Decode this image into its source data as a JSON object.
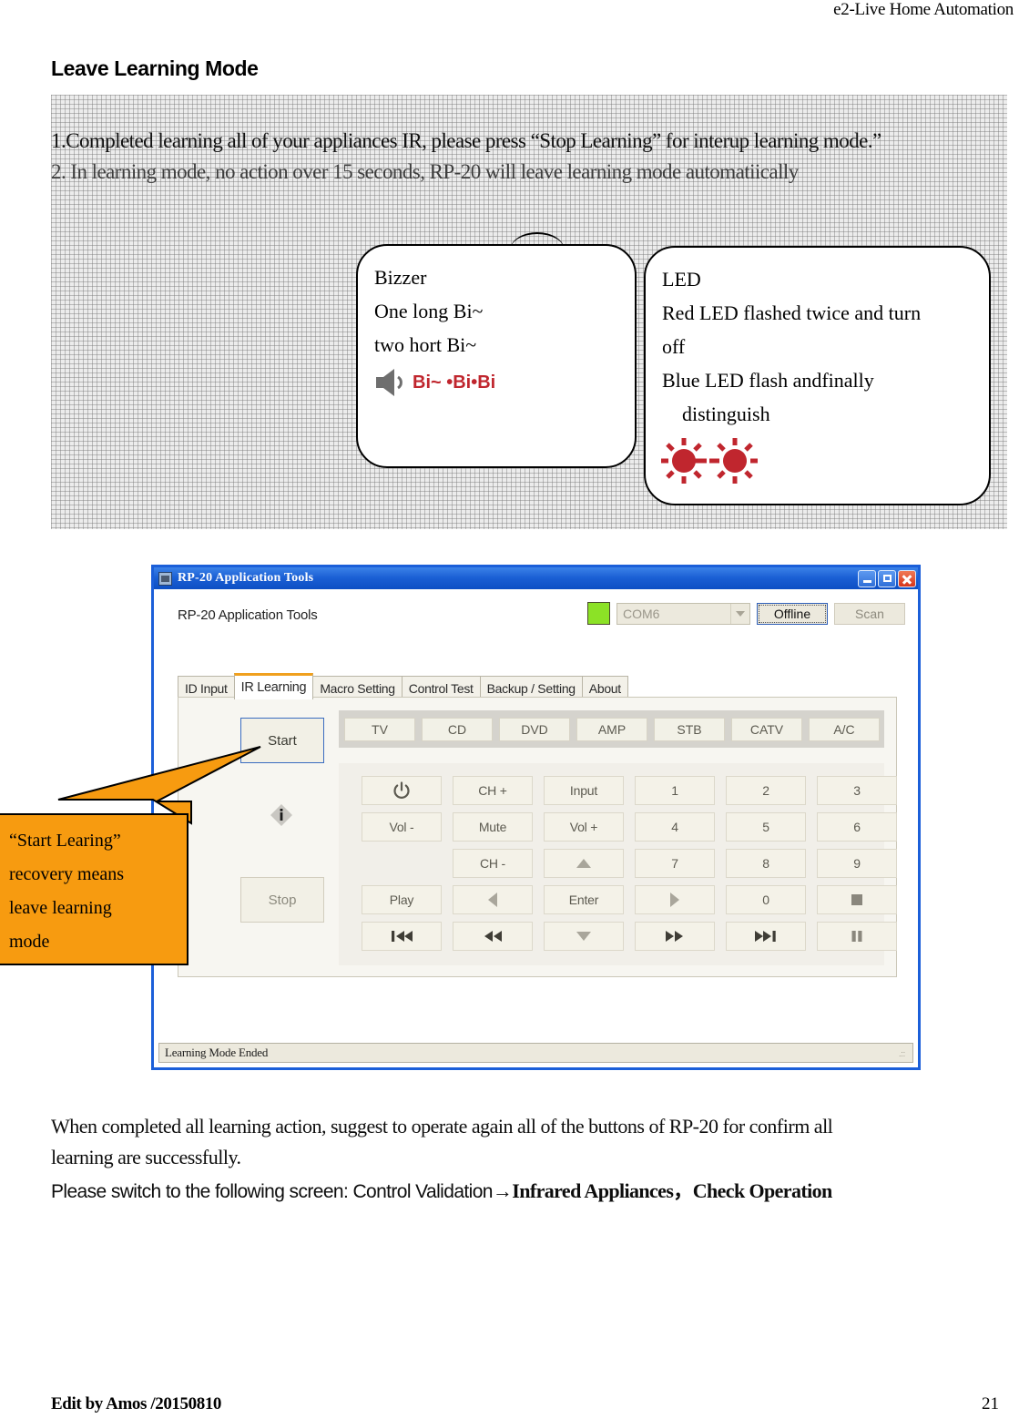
{
  "header": {
    "running_head": "e2-Live Home Automation"
  },
  "section": {
    "title": "Leave Learning Mode",
    "note1": "1.Completed learning all of your appliances IR, please press “Stop Learning” for interup learning mode.”",
    "note2": "2. In learning mode, no action over 15 seconds, RP-20 will leave learning mode automatiically"
  },
  "balloons": {
    "bizzer": {
      "line1": "Bizzer",
      "line2": "One long Bi~",
      "line3": "two hort Bi~",
      "icon": "speaker-icon",
      "beep_text": "Bi~ •Bi•Bi",
      "beep_color": "#c0262e"
    },
    "led": {
      "line1": "LED",
      "line2": "Red LED flashed twice and turn",
      "line3": "off",
      "line4": "Blue LED flash andfinally",
      "line5": "distinguish",
      "icon": "led-flash-icon",
      "icon_color": "#c0262e"
    }
  },
  "app": {
    "title": "RP-20 Application Tools",
    "subtitle": "RP-20 Application Tools",
    "window_buttons": {
      "minimize": "minimize-icon",
      "maximize": "maximize-icon",
      "close": "close-icon"
    },
    "connection": {
      "status_color": "#8ce226",
      "com_port": "COM6",
      "offline_label": "Offline",
      "scan_label": "Scan"
    },
    "tabs": [
      {
        "label": "ID Input",
        "active": false
      },
      {
        "label": "IR Learning",
        "active": true
      },
      {
        "label": "Macro Setting",
        "active": false
      },
      {
        "label": "Control Test",
        "active": false
      },
      {
        "label": "Backup / Setting",
        "active": false
      },
      {
        "label": "About",
        "active": false
      }
    ],
    "active_tab_accent": "#f0a01e",
    "learning_panel": {
      "start_label": "Start",
      "stop_label": "Stop",
      "info_icon": "info-icon"
    },
    "devices": [
      "TV",
      "CD",
      "DVD",
      "AMP",
      "STB",
      "CATV",
      "A/C"
    ],
    "keys": [
      [
        {
          "label": "",
          "icon": "power-icon"
        },
        {
          "label": "CH +",
          "icon": ""
        },
        {
          "label": "Input",
          "icon": ""
        },
        {
          "label": "1",
          "icon": ""
        },
        {
          "label": "2",
          "icon": ""
        },
        {
          "label": "3",
          "icon": ""
        }
      ],
      [
        {
          "label": "Vol -",
          "icon": ""
        },
        {
          "label": "Mute",
          "icon": ""
        },
        {
          "label": "Vol +",
          "icon": ""
        },
        {
          "label": "4",
          "icon": ""
        },
        {
          "label": "5",
          "icon": ""
        },
        {
          "label": "6",
          "icon": ""
        }
      ],
      [
        {
          "label": "",
          "icon": "blank"
        },
        {
          "label": "CH -",
          "icon": ""
        },
        {
          "label": "",
          "icon": "arrow-up-icon"
        },
        {
          "label": "7",
          "icon": ""
        },
        {
          "label": "8",
          "icon": ""
        },
        {
          "label": "9",
          "icon": ""
        }
      ],
      [
        {
          "label": "Play",
          "icon": ""
        },
        {
          "label": "",
          "icon": "arrow-left-icon"
        },
        {
          "label": "Enter",
          "icon": ""
        },
        {
          "label": "",
          "icon": "arrow-right-icon"
        },
        {
          "label": "0",
          "icon": ""
        },
        {
          "label": "",
          "icon": "stop-square-icon"
        }
      ],
      [
        {
          "label": "",
          "icon": "skip-previous-icon"
        },
        {
          "label": "",
          "icon": "rewind-icon"
        },
        {
          "label": "",
          "icon": "arrow-down-icon"
        },
        {
          "label": "",
          "icon": "fast-forward-icon"
        },
        {
          "label": "",
          "icon": "skip-next-icon"
        },
        {
          "label": "",
          "icon": "pause-icon"
        }
      ]
    ],
    "statusbar": "Learning Mode Ended"
  },
  "annotation": {
    "orange_callout": {
      "line1": "“Start Learing”",
      "line2": "recovery means",
      "line3": "leave learning",
      "line4": "mode",
      "color": "#f79b10"
    }
  },
  "body_text": {
    "p1": "When completed all learning action, suggest to operate again all of the buttons of RP-20 for confirm all",
    "p2": "learning are successfully.",
    "p3_plain": "Please switch to the following screen: Control Validation",
    "p3_bold": "→Infrared Appliances，Check Operation"
  },
  "footer": {
    "edited_by": "Edit by Amos /20150810",
    "page_number": "21"
  }
}
